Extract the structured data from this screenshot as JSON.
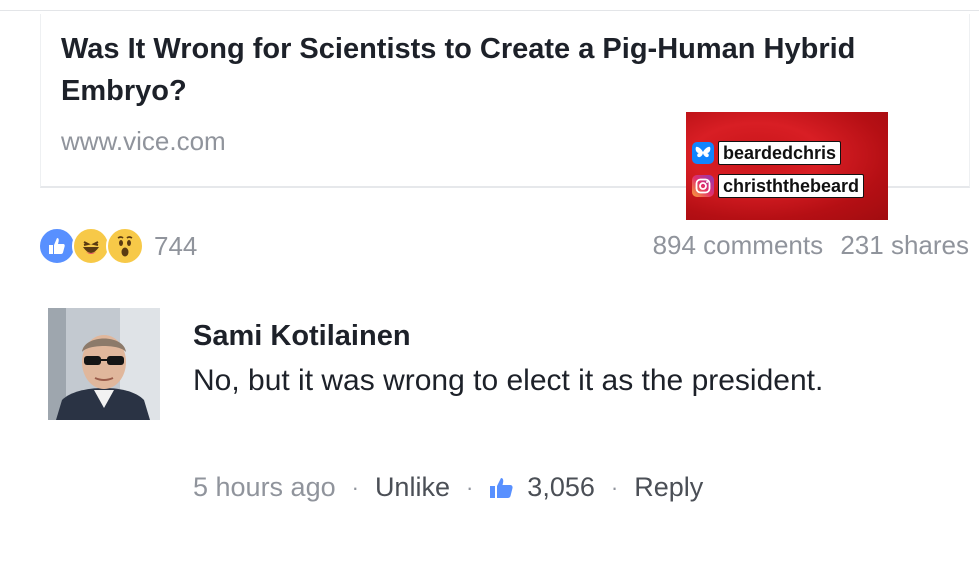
{
  "link_preview": {
    "title": "Was It Wrong for Scientists to Create a Pig-Human Hybrid Embryo?",
    "domain": "www.vice.com"
  },
  "watermark": {
    "handles": [
      {
        "icon": "butterfly-icon",
        "label": "beardedchris"
      },
      {
        "icon": "instagram-icon",
        "label": "christhthebeard"
      }
    ]
  },
  "reactions": {
    "icons": [
      "like-icon",
      "haha-icon",
      "wow-icon"
    ],
    "count": "744"
  },
  "stats": {
    "comments": "894 comments",
    "shares": "231 shares"
  },
  "comment": {
    "author": "Sami Kotilainen",
    "text": "No, but it was wrong to elect it as the president.",
    "time": "5 hours ago",
    "unlike_label": "Unlike",
    "like_count": "3,056",
    "reply_label": "Reply",
    "separator": "·"
  },
  "colors": {
    "meta_text": "#90949c",
    "body_text": "#1d2129",
    "like_blue": "#5890ff",
    "watermark_red": "#c8151a"
  }
}
